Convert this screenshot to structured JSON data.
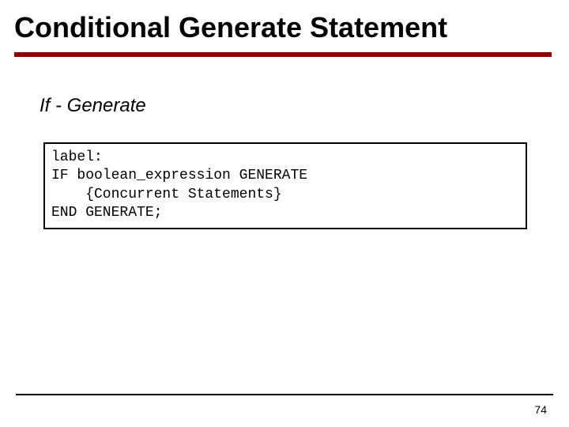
{
  "title": "Conditional Generate Statement",
  "subtitle": "If - Generate",
  "code": {
    "line1": "label:",
    "line2": "IF boolean_expression GENERATE",
    "line3": "    {Concurrent Statements}",
    "line4": "END GENERATE;"
  },
  "page_number": "74",
  "colors": {
    "accent": "#8b0000"
  }
}
